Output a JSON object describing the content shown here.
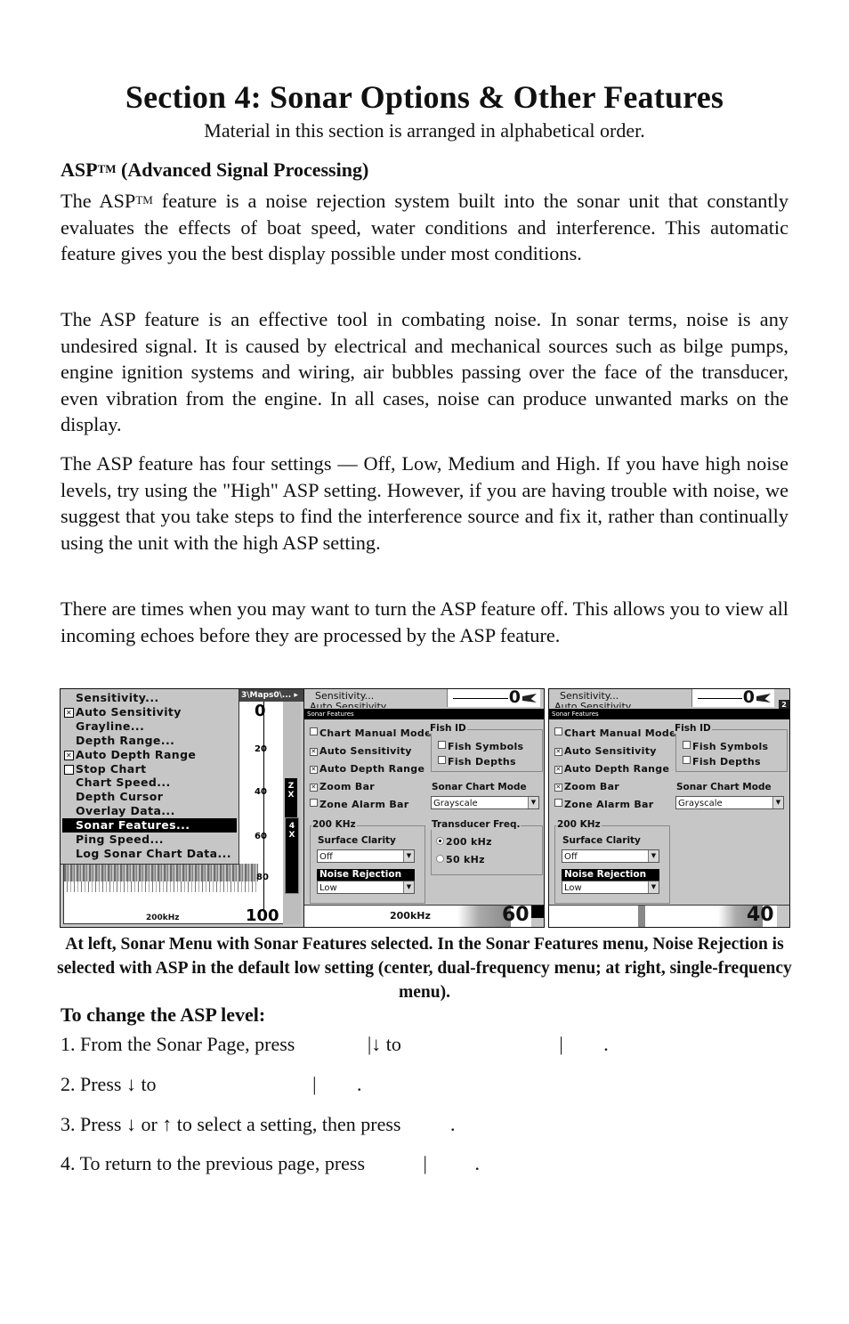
{
  "document": {
    "section_title": "Section 4: Sonar Options & Other Features",
    "section_subtitle": "Material in this section is arranged in alphabetical order.",
    "heading": {
      "prefix": "ASP",
      "tm": "TM",
      "suffix": " (Advanced Signal Processing)"
    },
    "paragraphs": [
      {
        "before_tm": "The ASP",
        "tm": "TM",
        "after_tm": " feature is a noise rejection system built into the sonar unit that constantly evaluates the effects of boat speed, water conditions and interference. This automatic feature gives you the best display possible under most conditions."
      },
      {
        "text": "The ASP feature is an effective tool in combating noise. In sonar terms, noise is any undesired signal. It is caused by electrical and mechanical sources such as bilge pumps, engine ignition systems and wiring, air bubbles passing over the face of the transducer, even vibration from the engine. In all cases, noise can produce unwanted marks on the display."
      },
      {
        "text": "The ASP feature has four settings — Off, Low, Medium and High. If you have high noise levels, try using the \"High\" ASP setting. However, if you are having trouble with noise, we suggest that you take steps to find the interference source and fix it, rather than continually using the unit with the high ASP setting."
      },
      {
        "text": "There are times when you may want to turn the ASP feature off. This allows you to view all incoming echoes before they are processed by the ASP feature."
      }
    ],
    "caption": "At left, Sonar Menu with Sonar Features selected. In the Sonar Features menu, Noise Rejection is selected with ASP in the default low setting (center, dual-frequency menu; at right, single-frequency menu).",
    "procedure_heading": "To change the ASP level:",
    "steps": [
      {
        "a": "1. From the Sonar Page, press ",
        "b": "|↓ to ",
        "c": "| ",
        "d": "."
      },
      {
        "a": "2. Press ↓ to ",
        "b": "| ",
        "c": "."
      },
      {
        "a": "3. Press ↓ or ↑ to select a setting, then press ",
        "b": "."
      },
      {
        "a": "4. To return to the previous page, press ",
        "b": "| ",
        "c": "."
      }
    ]
  },
  "screens": {
    "left": {
      "title_bar": "3\\Maps0\\...  ▸",
      "menu_items": [
        {
          "label": "Sensitivity...",
          "checkbox": null
        },
        {
          "label": "Auto Sensitivity",
          "checkbox": true
        },
        {
          "label": "Grayline...",
          "checkbox": null
        },
        {
          "label": "Depth Range...",
          "checkbox": null
        },
        {
          "label": "Auto Depth Range",
          "checkbox": true
        },
        {
          "label": "Stop Chart",
          "checkbox": false
        },
        {
          "label": "Chart Speed...",
          "checkbox": null
        },
        {
          "label": "Depth Cursor",
          "checkbox": null
        },
        {
          "label": "Overlay Data...",
          "checkbox": null
        },
        {
          "label": "Sonar Features...",
          "checkbox": null,
          "selected": true
        },
        {
          "label": "Ping Speed...",
          "checkbox": null
        },
        {
          "label": "Log Sonar Chart Data...",
          "checkbox": null
        }
      ],
      "depth_scale": [
        "0",
        "20",
        "40",
        "60",
        "80",
        "100"
      ],
      "zoom_labels": [
        "Z X",
        "4 X"
      ],
      "frequency": "200kHz"
    },
    "center": {
      "behind_items": [
        "Sensitivity...",
        "Auto Sensitivity"
      ],
      "top_depth": "0",
      "dialog_title": "Sonar Features",
      "options": [
        {
          "label": "Chart Manual Mode",
          "checked": false
        },
        {
          "label": "Auto Sensitivity",
          "checked": true
        },
        {
          "label": "Auto Depth Range",
          "checked": true
        },
        {
          "label": "Zoom Bar",
          "checked": true
        },
        {
          "label": "Zone Alarm Bar",
          "checked": false
        }
      ],
      "fish_id": {
        "label": "Fish ID",
        "items": [
          {
            "label": "Fish Symbols",
            "checked": false
          },
          {
            "label": "Fish Depths",
            "checked": false
          }
        ]
      },
      "chart_mode": {
        "label": "Sonar Chart Mode",
        "value": "Grayscale"
      },
      "freq_group": {
        "label": "200 KHz",
        "surface_clarity_label": "Surface Clarity",
        "surface_clarity_value": "Off",
        "noise_rejection_label": "Noise Rejection",
        "noise_rejection_value": "Low"
      },
      "transducer": {
        "label": "Transducer Freq.",
        "options": [
          {
            "label": "200 kHz",
            "selected": true
          },
          {
            "label": "50 kHz",
            "selected": false
          }
        ]
      },
      "bottom_freq": "200kHz",
      "bottom_depth": "60"
    },
    "right": {
      "behind_items": [
        "Sensitivity...",
        "Auto Sensitivity"
      ],
      "top_depth": "0",
      "zoom_badge": "2",
      "dialog_title": "Sonar Features",
      "options": [
        {
          "label": "Chart Manual Mode",
          "checked": false
        },
        {
          "label": "Auto Sensitivity",
          "checked": true
        },
        {
          "label": "Auto Depth Range",
          "checked": true
        },
        {
          "label": "Zoom Bar",
          "checked": true
        },
        {
          "label": "Zone Alarm Bar",
          "checked": false
        }
      ],
      "fish_id": {
        "label": "Fish ID",
        "items": [
          {
            "label": "Fish Symbols",
            "checked": false
          },
          {
            "label": "Fish Depths",
            "checked": false
          }
        ]
      },
      "chart_mode": {
        "label": "Sonar Chart Mode",
        "value": "Grayscale"
      },
      "freq_group": {
        "label": "200 KHz",
        "surface_clarity_label": "Surface Clarity",
        "surface_clarity_value": "Off",
        "noise_rejection_label": "Noise Rejection",
        "noise_rejection_value": "Low"
      },
      "bottom_depth": "40"
    }
  }
}
